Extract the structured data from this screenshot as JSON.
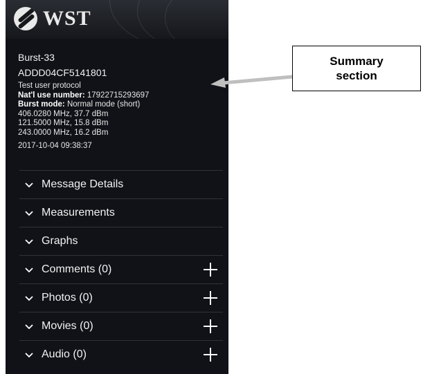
{
  "app": {
    "logo_text": "WST",
    "logo_icon": "wst-logo-icon"
  },
  "summary": {
    "name": "Burst-33",
    "id": "ADDD04CF5141801",
    "protocol": "Test user protocol",
    "natl_use_label": "Nat'l use number:",
    "natl_use_value": "17922715293697",
    "burst_mode_label": "Burst mode:",
    "burst_mode_value": "Normal mode (short)",
    "freq_1": "406.0280 MHz, 37.7 dBm",
    "freq_2": "121.5000 MHz, 15.8 dBm",
    "freq_3": "243.0000 MHz, 16.2 dBm",
    "timestamp": "2017-10-04 09:38:37"
  },
  "sections": [
    {
      "label": "Message Details",
      "icon": "chevron-down-icon",
      "has_add": false
    },
    {
      "label": "Measurements",
      "icon": "chevron-down-icon",
      "has_add": false
    },
    {
      "label": "Graphs",
      "icon": "chevron-down-icon",
      "has_add": false
    },
    {
      "label": "Comments (0)",
      "icon": "chevron-down-icon",
      "has_add": true,
      "add_icon": "plus-icon"
    },
    {
      "label": "Photos (0)",
      "icon": "chevron-down-icon",
      "has_add": true,
      "add_icon": "plus-icon"
    },
    {
      "label": "Movies (0)",
      "icon": "chevron-down-icon",
      "has_add": true,
      "add_icon": "plus-icon"
    },
    {
      "label": "Audio (0)",
      "icon": "chevron-down-icon",
      "has_add": true,
      "add_icon": "plus-icon"
    }
  ],
  "annotation": {
    "label_line1": "Summary",
    "label_line2": "section",
    "arrow_color": "#bfbfbf"
  },
  "colors": {
    "background": "#101217",
    "divider": "#2f333a",
    "text": "#f2f2f2"
  }
}
